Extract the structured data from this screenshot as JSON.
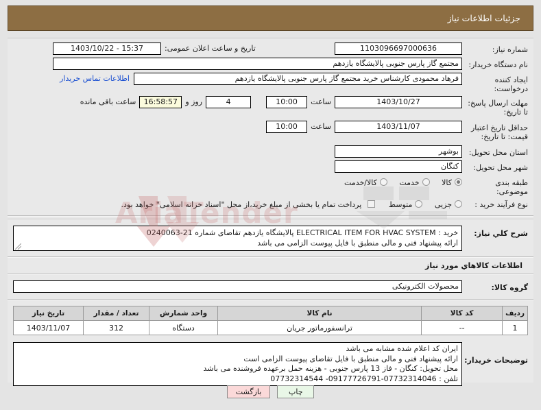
{
  "header": {
    "title": "جزئیات اطلاعات نیاز"
  },
  "form": {
    "need_number_label": "شماره نیاز:",
    "need_number_value": "1103096697000636",
    "announce_label": "تاریخ و ساعت اعلان عمومی:",
    "announce_value": "1403/10/22 - 15:37",
    "buyer_org_label": "نام دستگاه خریدار:",
    "buyer_org_value": "مجتمع گاز پارس جنوبی  پالایشگاه یازدهم",
    "requester_label": "ایجاد کننده درخواست:",
    "requester_value": "فرهاد محمودی کارشناس خرید مجتمع گاز پارس جنوبی  پالایشگاه یازدهم",
    "contact_link": "اطلاعات تماس خریدار",
    "deadline_label": "مهلت ارسال پاسخ: تا تاریخ:",
    "deadline_date": "1403/10/27",
    "hour_label": "ساعت",
    "deadline_time": "10:00",
    "remaining_days": "4",
    "remaining_days_suffix": "روز و",
    "remaining_clock": "16:58:57",
    "remaining_suffix": "ساعت باقی مانده",
    "price_validity_label": "حداقل تاریخ اعتبار قیمت: تا تاریخ:",
    "price_validity_date": "1403/11/07",
    "price_validity_time": "10:00",
    "province_label": "استان محل تحویل:",
    "province_value": "بوشهر",
    "city_label": "شهر محل تحویل:",
    "city_value": "کنگان",
    "classification_label": "طبقه بندی موضوعی:",
    "classification_options": [
      "کالا",
      "خدمت",
      "کالا/خدمت"
    ],
    "classification_selected": 0,
    "process_label": "نوع فرآیند خرید :",
    "process_options": [
      "جزیی",
      "متوسط"
    ],
    "process_selected": -1,
    "treasury_note": "پرداخت تمام یا بخشی از مبلغ خرید،از محل \"اسناد خزانه اسلامی\" خواهد بود.",
    "treasury_checked": false
  },
  "description": {
    "label": "شرح كلي نياز:",
    "line1_prefix": "خرید : ",
    "line1_en": "ELECTRICAL ITEM FOR HVAC SYSTEM",
    "line1_suffix": " پالایشگاه یازدهم تقاضای شماره 21-0240063",
    "line2": "ارائه پیشنهاد فنی و مالی منطبق با فایل پیوست الزامی می باشد"
  },
  "goods": {
    "section_title": "اطلاعات كالاهاي مورد نياز",
    "group_label": "گروه كالا:",
    "group_value": "محصولات الکترونیکی",
    "table": {
      "headers": [
        "ردیف",
        "کد کالا",
        "نام کالا",
        "واحد شمارش",
        "تعداد / مقدار",
        "تاریخ نیاز"
      ],
      "rows": [
        [
          "1",
          "--",
          "ترانسفورماتور جریان",
          "دستگاه",
          "312",
          "1403/11/07"
        ]
      ]
    }
  },
  "notes": {
    "label": "توضیحات خریدار:",
    "lines": [
      "ایران کد اعلام شده مشابه می باشد",
      "ارائه پیشنهاد فنی و مالی منطبق با فایل تقاضای پیوست الزامی است",
      "محل تحویل: کنگان - فاز 13 پارس جنوبی - هزینه حمل برعهده فروشنده می باشد",
      "تلفن : 07732314046-09177726791- 07732314544"
    ]
  },
  "footer": {
    "print_label": "چاپ",
    "back_label": "بازگشت"
  },
  "watermark": {
    "text": "AriaTender"
  },
  "colors": {
    "header_bg": "#8d6e43",
    "page_bg": "#e4e4e4",
    "panel_bg": "#e9e9e9",
    "link": "#1a4fd1",
    "countdown_bg": "#fbfbdd",
    "print_btn": "#e9f7e7",
    "back_btn": "#fbd9d9",
    "table_header": "#d6d6d6"
  }
}
